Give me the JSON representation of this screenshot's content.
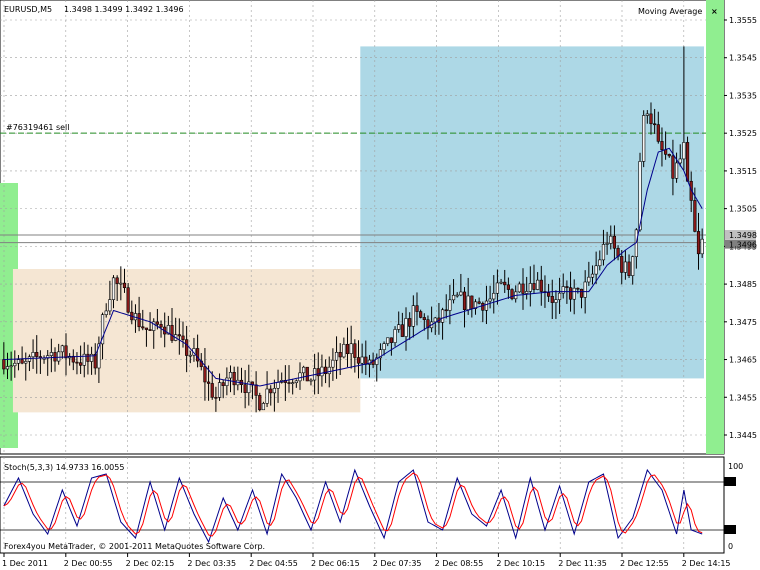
{
  "header": {
    "symbol_timeframe": "EURUSD,M5",
    "ohlc": "1.3498 1.3499 1.3492 1.3496",
    "indicator_name": "Moving Average",
    "close_glyph": "×"
  },
  "trade": {
    "label": "#76319461 sell",
    "price": 1.3525,
    "line_color": "#228b22"
  },
  "price_tags": {
    "ask": "1.3498",
    "bid": "1.3496"
  },
  "stoch": {
    "label": "Stoch(5,3,3) 14.9733 16.0055",
    "levels": [
      80,
      20
    ],
    "scale_labels": [
      "100",
      "80",
      "20",
      "0"
    ],
    "main_color": "#00008b",
    "signal_color": "#ff0000"
  },
  "copyright": "Forex4you MetaTrader, © 2001-2011 MetaQuotes Software Corp.",
  "colors": {
    "bull": "#f5f5f5",
    "bear": "#8b1a1a",
    "wick": "#000000",
    "ma": "#00008b",
    "grid": "#a0a0a0",
    "zone_blue": "#add8e6",
    "zone_tan": "#f5e6d3",
    "green_band": "#90ee90"
  },
  "chart_data": {
    "type": "candlestick",
    "symbol": "EURUSD",
    "timeframe": "M5",
    "y_axis": {
      "min": 1.344,
      "max": 1.356,
      "ticks": [
        "1.3555",
        "1.3545",
        "1.3535",
        "1.3525",
        "1.3515",
        "1.3505",
        "1.3495",
        "1.3485",
        "1.3475",
        "1.3465",
        "1.3455",
        "1.3445"
      ]
    },
    "x_ticks": [
      "1 Dec 2011",
      "2 Dec 00:55",
      "2 Dec 02:15",
      "2 Dec 03:35",
      "2 Dec 04:55",
      "2 Dec 06:15",
      "2 Dec 07:35",
      "2 Dec 08:55",
      "2 Dec 10:15",
      "2 Dec 11:35",
      "2 Dec 12:55",
      "2 Dec 14:15"
    ],
    "price_anchors": [
      [
        0,
        1.3465
      ],
      [
        5,
        1.3463
      ],
      [
        10,
        1.3466
      ],
      [
        15,
        1.3467
      ],
      [
        20,
        1.3465
      ],
      [
        25,
        1.3464
      ],
      [
        26,
        1.347
      ],
      [
        28,
        1.348
      ],
      [
        30,
        1.3486
      ],
      [
        33,
        1.3482
      ],
      [
        36,
        1.3476
      ],
      [
        40,
        1.3472
      ],
      [
        43,
        1.3475
      ],
      [
        46,
        1.3472
      ],
      [
        49,
        1.3468
      ],
      [
        52,
        1.3466
      ],
      [
        54,
        1.3462
      ],
      [
        56,
        1.3458
      ],
      [
        58,
        1.3455
      ],
      [
        61,
        1.346
      ],
      [
        64,
        1.3461
      ],
      [
        67,
        1.3457
      ],
      [
        70,
        1.3454
      ],
      [
        73,
        1.3458
      ],
      [
        76,
        1.346
      ],
      [
        80,
        1.3461
      ],
      [
        84,
        1.346
      ],
      [
        88,
        1.3462
      ],
      [
        92,
        1.3466
      ],
      [
        95,
        1.3468
      ],
      [
        98,
        1.3465
      ],
      [
        100,
        1.3463
      ],
      [
        103,
        1.3466
      ],
      [
        106,
        1.347
      ],
      [
        109,
        1.3473
      ],
      [
        112,
        1.3477
      ],
      [
        115,
        1.3475
      ],
      [
        118,
        1.3474
      ],
      [
        121,
        1.3478
      ],
      [
        124,
        1.3481
      ],
      [
        127,
        1.348
      ],
      [
        130,
        1.348
      ],
      [
        133,
        1.3481
      ],
      [
        136,
        1.3484
      ],
      [
        139,
        1.3483
      ],
      [
        142,
        1.3485
      ],
      [
        145,
        1.3486
      ],
      [
        148,
        1.3484
      ],
      [
        151,
        1.348
      ],
      [
        154,
        1.3483
      ],
      [
        157,
        1.3482
      ],
      [
        160,
        1.3485
      ],
      [
        163,
        1.3492
      ],
      [
        165,
        1.3497
      ],
      [
        167,
        1.3494
      ],
      [
        169,
        1.349
      ],
      [
        171,
        1.3488
      ],
      [
        173,
        1.35
      ],
      [
        174,
        1.3518
      ],
      [
        175,
        1.3528
      ],
      [
        176,
        1.3532
      ],
      [
        177,
        1.3529
      ],
      [
        178,
        1.3526
      ],
      [
        179,
        1.3521
      ],
      [
        181,
        1.3519
      ],
      [
        183,
        1.3514
      ],
      [
        185,
        1.3518
      ],
      [
        186,
        1.3521
      ],
      [
        187,
        1.351
      ],
      [
        188,
        1.3506
      ],
      [
        189,
        1.3498
      ],
      [
        190,
        1.3492
      ],
      [
        191,
        1.3496
      ]
    ],
    "moving_average_anchors": [
      [
        0,
        1.3465
      ],
      [
        25,
        1.3466
      ],
      [
        30,
        1.3478
      ],
      [
        40,
        1.3475
      ],
      [
        50,
        1.3469
      ],
      [
        58,
        1.346
      ],
      [
        70,
        1.3458
      ],
      [
        90,
        1.3462
      ],
      [
        100,
        1.3464
      ],
      [
        110,
        1.347
      ],
      [
        120,
        1.3476
      ],
      [
        130,
        1.3479
      ],
      [
        140,
        1.3482
      ],
      [
        150,
        1.3483
      ],
      [
        160,
        1.3483
      ],
      [
        165,
        1.349
      ],
      [
        170,
        1.3494
      ],
      [
        173,
        1.3496
      ],
      [
        176,
        1.351
      ],
      [
        179,
        1.352
      ],
      [
        182,
        1.3521
      ],
      [
        186,
        1.3515
      ],
      [
        188,
        1.351
      ],
      [
        191,
        1.3505
      ]
    ],
    "stoch_anchors": [
      [
        0,
        50
      ],
      [
        4,
        85
      ],
      [
        8,
        40
      ],
      [
        12,
        15
      ],
      [
        16,
        70
      ],
      [
        20,
        25
      ],
      [
        24,
        85
      ],
      [
        28,
        90
      ],
      [
        32,
        30
      ],
      [
        36,
        10
      ],
      [
        40,
        80
      ],
      [
        44,
        20
      ],
      [
        48,
        85
      ],
      [
        52,
        40
      ],
      [
        56,
        5
      ],
      [
        60,
        60
      ],
      [
        64,
        20
      ],
      [
        68,
        70
      ],
      [
        72,
        15
      ],
      [
        76,
        90
      ],
      [
        80,
        60
      ],
      [
        84,
        20
      ],
      [
        88,
        80
      ],
      [
        92,
        30
      ],
      [
        96,
        95
      ],
      [
        100,
        50
      ],
      [
        104,
        10
      ],
      [
        108,
        80
      ],
      [
        112,
        95
      ],
      [
        116,
        30
      ],
      [
        120,
        20
      ],
      [
        124,
        85
      ],
      [
        128,
        40
      ],
      [
        132,
        25
      ],
      [
        136,
        70
      ],
      [
        140,
        10
      ],
      [
        144,
        85
      ],
      [
        148,
        20
      ],
      [
        152,
        75
      ],
      [
        156,
        15
      ],
      [
        160,
        80
      ],
      [
        164,
        90
      ],
      [
        168,
        10
      ],
      [
        172,
        35
      ],
      [
        176,
        95
      ],
      [
        180,
        70
      ],
      [
        184,
        15
      ],
      [
        186,
        70
      ],
      [
        188,
        20
      ],
      [
        191,
        15
      ]
    ],
    "zones": [
      {
        "kind": "tan",
        "from_bar": 3,
        "to_bar": 97,
        "price_from": 1.3451,
        "price_to": 1.3489
      },
      {
        "kind": "blue",
        "from_bar": 98,
        "to_bar": 191,
        "price_from": 1.346,
        "price_to": 1.3548
      }
    ]
  }
}
